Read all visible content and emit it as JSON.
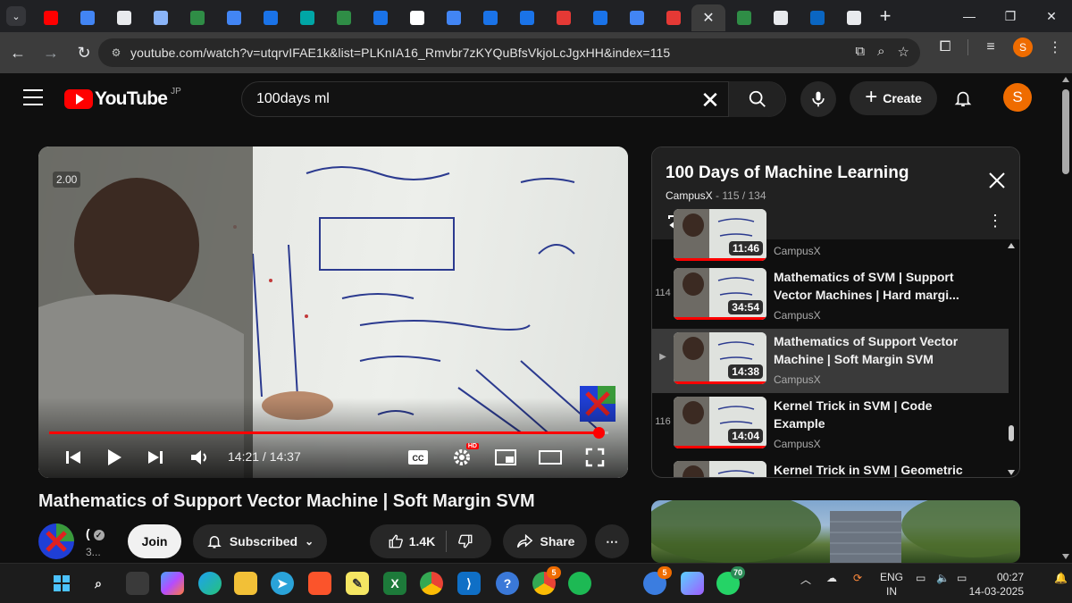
{
  "browser": {
    "tabs": [
      {
        "icon": "youtube-icon",
        "color": "#ff0000"
      },
      {
        "icon": "google-icon",
        "color": "#4285f4"
      },
      {
        "icon": "openai-icon",
        "color": "#e8eaed"
      },
      {
        "icon": "slides-icon",
        "color": "#8ab4f8"
      },
      {
        "icon": "geeksforgeeks-icon",
        "color": "#2f8d46"
      },
      {
        "icon": "google-icon",
        "color": "#4285f4"
      },
      {
        "icon": "c-icon",
        "color": "#1a73e8"
      },
      {
        "icon": "bookmark-icon",
        "color": "#00a6a6"
      },
      {
        "icon": "geeksforgeeks-icon",
        "color": "#2f8d46"
      },
      {
        "icon": "c-icon",
        "color": "#1a73e8"
      },
      {
        "icon": "medium-icon",
        "color": "#ffffff"
      },
      {
        "icon": "google-icon",
        "color": "#4285f4"
      },
      {
        "icon": "c-icon",
        "color": "#1a73e8"
      },
      {
        "icon": "c-icon",
        "color": "#1a73e8"
      },
      {
        "icon": "target-icon",
        "color": "#e53935"
      },
      {
        "icon": "c-icon",
        "color": "#1a73e8"
      },
      {
        "icon": "google-icon",
        "color": "#4285f4"
      },
      {
        "icon": "tuf-icon",
        "color": "#e53935"
      }
    ],
    "tabs_after_active": [
      {
        "icon": "geeksforgeeks-icon",
        "color": "#2f8d46"
      },
      {
        "icon": "chrome-icon",
        "color": "#e8eaed"
      },
      {
        "icon": "linkedin-icon",
        "color": "#0a66c2"
      },
      {
        "icon": "chrome-icon",
        "color": "#e8eaed"
      }
    ],
    "url": "youtube.com/watch?v=utqrvIFAE1k&list=PLKnIA16_Rmvbr7zKYQuBfsVkjoLcJgxHH&index=115",
    "profile_initial": "S"
  },
  "youtube": {
    "country_code": "JP",
    "logo_text": "YouTube",
    "search_value": "100days ml",
    "create_label": "Create",
    "avatar_initial": "S"
  },
  "player": {
    "speed": "2.00",
    "current_time": "14:21",
    "duration": "14:37",
    "time_display": "14:21 / 14:37",
    "progress": 0.982
  },
  "playlist": {
    "title": "100 Days of Machine Learning",
    "channel": "CampusX",
    "position": "115 / 134",
    "items": [
      {
        "index": "",
        "title": "",
        "channel": "CampusX",
        "duration": "11:46",
        "current": false
      },
      {
        "index": "114",
        "title": "Mathematics of SVM | Support Vector Machines | Hard margi...",
        "channel": "CampusX",
        "duration": "34:54",
        "current": false
      },
      {
        "index": "▶",
        "title": "Mathematics of Support Vector Machine | Soft Margin SVM",
        "channel": "CampusX",
        "duration": "14:38",
        "current": true
      },
      {
        "index": "116",
        "title": "Kernel Trick in SVM | Code Example",
        "channel": "CampusX",
        "duration": "14:04",
        "current": false
      },
      {
        "index": "",
        "title": "Kernel Trick in SVM | Geometric",
        "channel": "",
        "duration": "",
        "current": false
      }
    ]
  },
  "video": {
    "title": "Mathematics of Support Vector Machine | Soft Margin SVM",
    "channel_name": "(",
    "subscribers": "3...",
    "join_label": "Join",
    "subscribed_label": "Subscribed",
    "likes": "1.4K",
    "share_label": "Share"
  },
  "taskbar": {
    "language": "ENG",
    "region": "IN",
    "time": "00:27",
    "date": "14-03-2025",
    "chrome_badge": "5",
    "sider_badge": "5",
    "whatsapp_badge": "70"
  }
}
